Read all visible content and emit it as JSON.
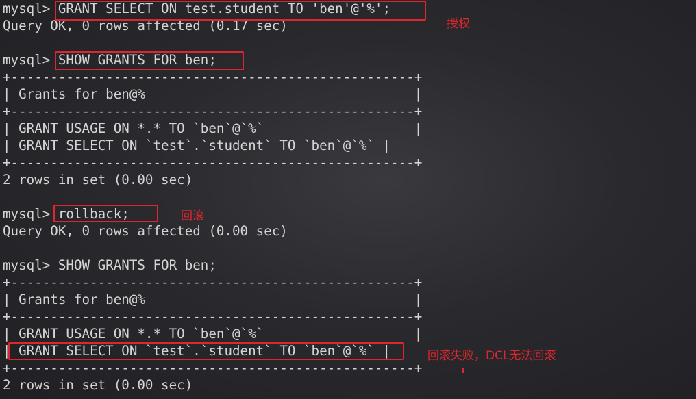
{
  "terminal": {
    "lines": [
      "mysql> GRANT SELECT ON test.student TO 'ben'@'%';",
      "Query OK, 0 rows affected (0.17 sec)",
      "",
      "mysql> SHOW GRANTS FOR ben;",
      "+---------------------------------------------------+",
      "| Grants for ben@%                                  |",
      "+---------------------------------------------------+",
      "| GRANT USAGE ON *.* TO `ben`@`%`                   |",
      "| GRANT SELECT ON `test`.`student` TO `ben`@`%` |",
      "+---------------------------------------------------+",
      "2 rows in set (0.00 sec)",
      "",
      "mysql> rollback;",
      "Query OK, 0 rows affected (0.00 sec)",
      "",
      "mysql> SHOW GRANTS FOR ben;",
      "+---------------------------------------------------+",
      "| Grants for ben@%                                  |",
      "+---------------------------------------------------+",
      "| GRANT USAGE ON *.* TO `ben`@`%`                   |",
      "| GRANT SELECT ON `test`.`student` TO `ben`@`%` |",
      "+---------------------------------------------------+",
      "2 rows in set (0.00 sec)"
    ]
  },
  "annotations": {
    "grant_note": "授权",
    "rollback_note": "回滚",
    "fail_note": "回滚失败，DCL无法回滚"
  },
  "colors": {
    "text": "#d4d4d4",
    "highlight": "#e0262c"
  }
}
